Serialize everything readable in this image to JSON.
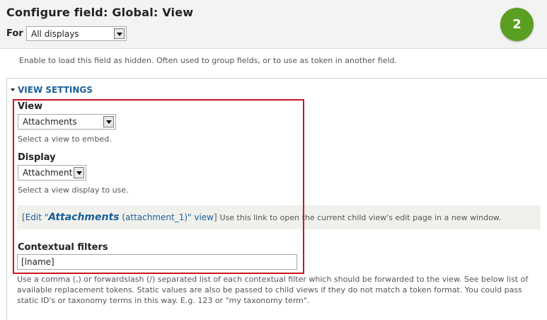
{
  "header": {
    "title": "Configure field: Global: View",
    "for_label": "For",
    "for_select_value": "All displays",
    "step_badge": "2"
  },
  "hidden_description": "Enable to load this field as hidden. Often used to group fields, or to use as token in another field.",
  "view_settings": {
    "legend": "VIEW SETTINGS",
    "view_label": "View",
    "view_value": "Attachments",
    "view_desc": "Select a view to embed.",
    "display_label": "Display",
    "display_value": "Attachment",
    "display_desc": "Select a view display to use.",
    "edit_link": {
      "bracket_open": "[",
      "prefix": "Edit \"",
      "name": "Attachments",
      "suffix": " (attachment_1)\" view",
      "bracket_close": "]",
      "note": "Use this link to open the current child view's edit page in a new window."
    },
    "contextual_label": "Contextual filters",
    "contextual_value": "[lname]",
    "contextual_desc": "Use a comma (,) or forwardslash (/) separated list of each contextual filter which should be forwarded to the view. See below list of available replacement tokens. Static values are also be passed to child views if they do not match a token format. You could pass static ID's or taxonomy terms in this way. E.g. 123 or \"my taxonomy term\"."
  },
  "colors": {
    "badge": "#5a9e22",
    "highlight_border": "#c8161d",
    "link": "#1a5e9a"
  }
}
